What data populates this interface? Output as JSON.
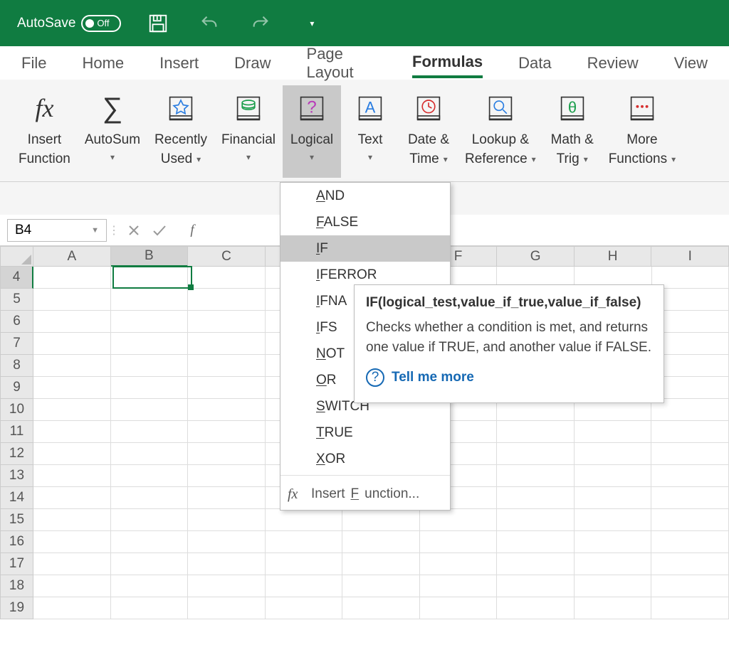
{
  "titlebar": {
    "autosave_label": "AutoSave",
    "autosave_state": "Off"
  },
  "tabs": [
    "File",
    "Home",
    "Insert",
    "Draw",
    "Page Layout",
    "Formulas",
    "Data",
    "Review",
    "View"
  ],
  "active_tab_index": 5,
  "ribbon": {
    "insert_function": "Insert\nFunction",
    "autosum": "AutoSum",
    "recently_used": "Recently\nUsed",
    "financial": "Financial",
    "logical": "Logical",
    "text": "Text",
    "date_time": "Date &\nTime",
    "lookup_ref": "Lookup &\nReference",
    "math_trig": "Math &\nTrig",
    "more_functions": "More\nFunctions"
  },
  "formula_bar": {
    "name_box": "B4"
  },
  "columns": [
    "A",
    "B",
    "C",
    "D",
    "E",
    "F",
    "G",
    "H",
    "I"
  ],
  "rows_start": 4,
  "rows_count": 16,
  "selected_col_index": 1,
  "selected_row": 4,
  "dropdown": {
    "items": [
      "AND",
      "FALSE",
      "IF",
      "IFERROR",
      "IFNA",
      "IFS",
      "NOT",
      "OR",
      "SWITCH",
      "TRUE",
      "XOR"
    ],
    "hover_index": 2,
    "footer": "Insert Function..."
  },
  "tooltip": {
    "title": "IF(logical_test,value_if_true,value_if_false)",
    "body": "Checks whether a condition is met, and returns one value if TRUE, and another value if FALSE.",
    "link": "Tell me more"
  }
}
